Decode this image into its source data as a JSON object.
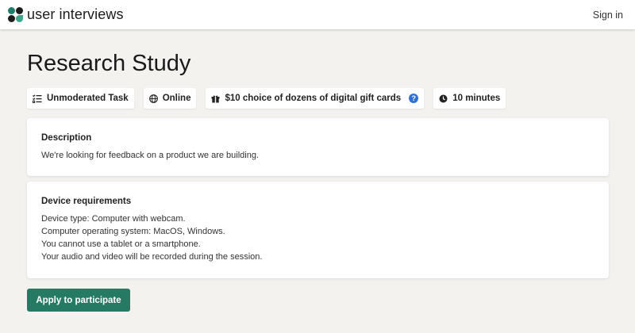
{
  "header": {
    "brand_name": "user interviews",
    "sign_in_label": "Sign in"
  },
  "page": {
    "title": "Research Study"
  },
  "tags": [
    {
      "label": "Unmoderated Task",
      "icon": "checklist-icon"
    },
    {
      "label": "Online",
      "icon": "globe-icon"
    },
    {
      "label": "$10 choice of dozens of digital gift cards",
      "icon": "gift-icon",
      "help": "?"
    },
    {
      "label": "10 minutes",
      "icon": "clock-icon"
    }
  ],
  "description": {
    "heading": "Description",
    "text": "We're looking for feedback on a product we are building."
  },
  "device_requirements": {
    "heading": "Device requirements",
    "lines": [
      "Device type: Computer with webcam.",
      "Computer operating system: MacOS, Windows.",
      "You cannot use a tablet or a smartphone.",
      "Your audio and video will be recorded during the session."
    ]
  },
  "apply_label": "Apply to participate",
  "colors": {
    "accent": "#257a64",
    "background": "#f4f2ef",
    "help_icon": "#2f6fd6"
  }
}
